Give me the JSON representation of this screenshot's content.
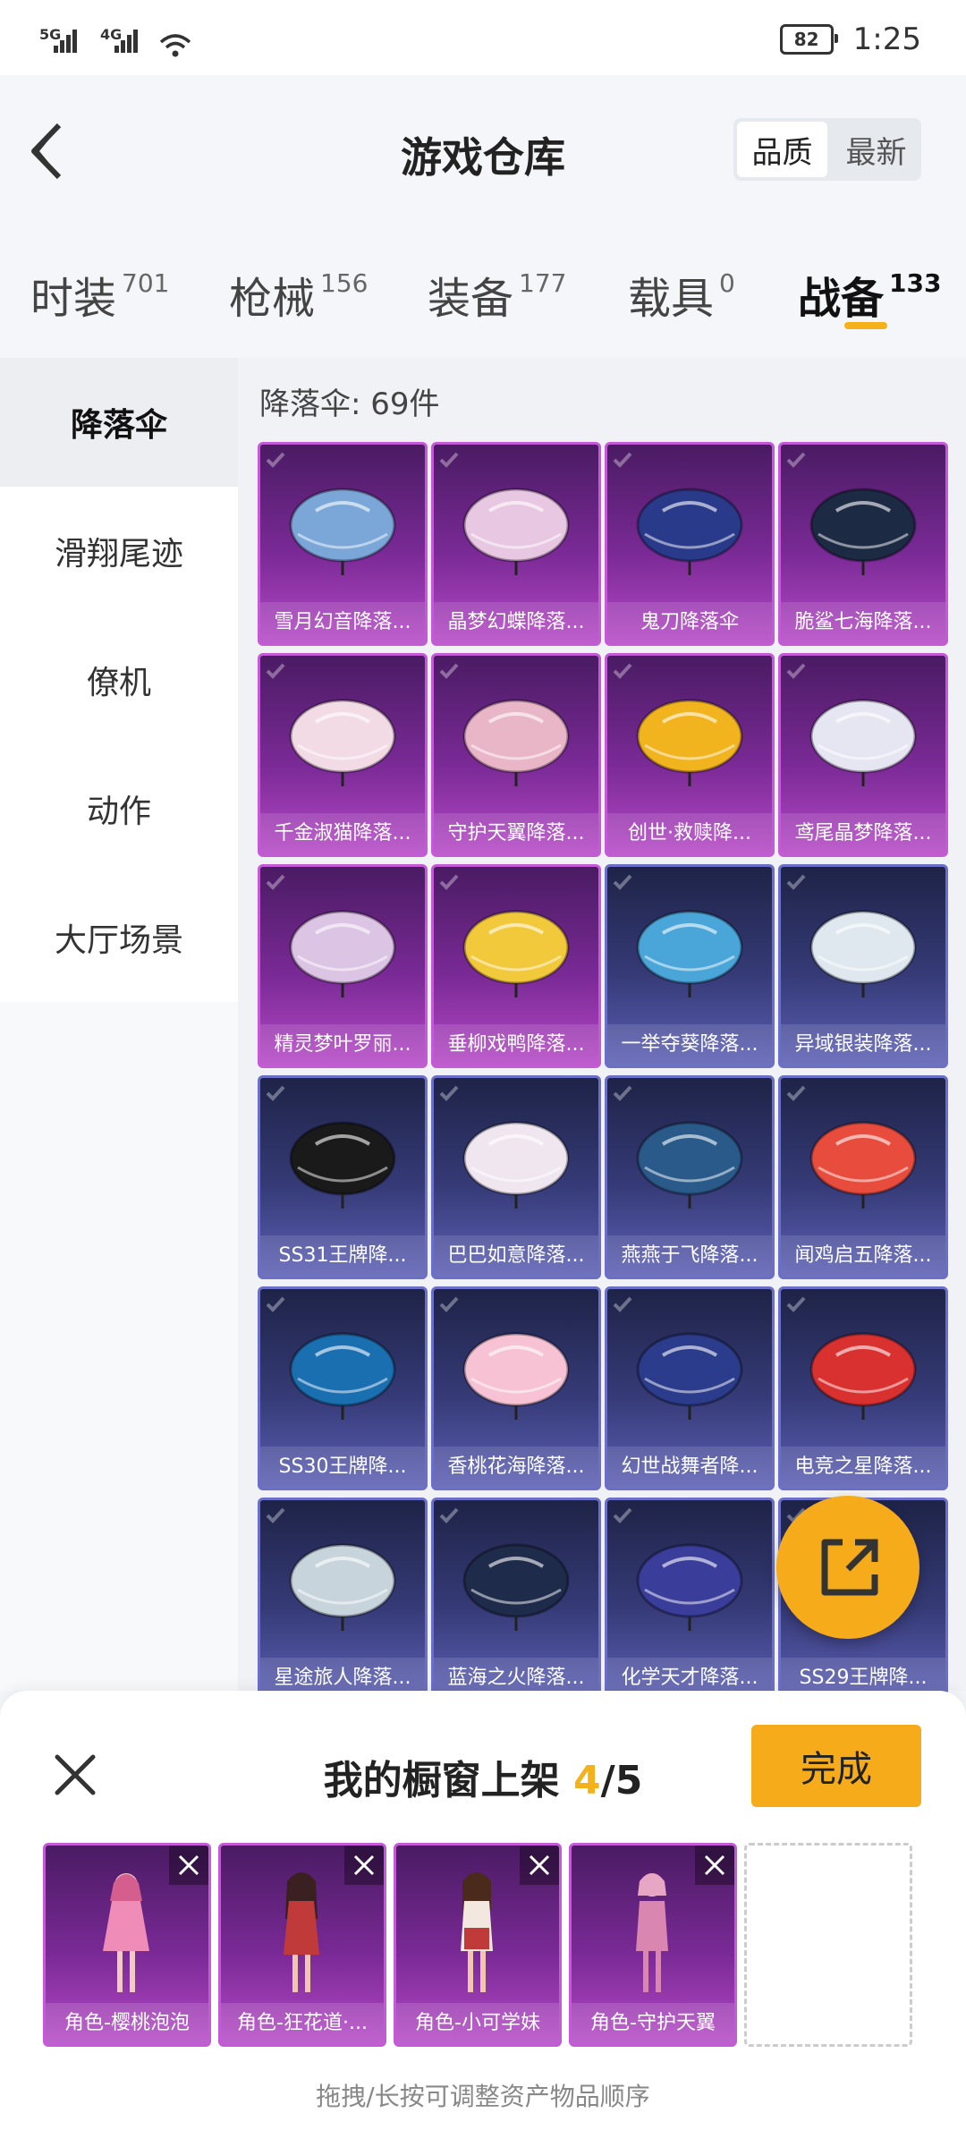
{
  "status": {
    "signal1": "5G",
    "signal2": "4G",
    "battery": "82",
    "time": "1:25"
  },
  "header": {
    "title": "游戏仓库",
    "sort_options": [
      "品质",
      "最新"
    ]
  },
  "tabs": [
    {
      "label": "时装",
      "count": "701"
    },
    {
      "label": "枪械",
      "count": "156"
    },
    {
      "label": "装备",
      "count": "177"
    },
    {
      "label": "载具",
      "count": "0"
    },
    {
      "label": "战备",
      "count": "133"
    }
  ],
  "sidebar": {
    "items": [
      "降落伞",
      "滑翔尾迹",
      "僚机",
      "动作",
      "大厅场景"
    ]
  },
  "main": {
    "count_label": "降落伞: 69件"
  },
  "items": [
    {
      "label": "雪月幻音降落...",
      "tier": "purple"
    },
    {
      "label": "晶梦幻蝶降落...",
      "tier": "purple"
    },
    {
      "label": "鬼刀降落伞",
      "tier": "purple"
    },
    {
      "label": "脆鲨七海降落...",
      "tier": "purple"
    },
    {
      "label": "千金淑猫降落...",
      "tier": "purple"
    },
    {
      "label": "守护天翼降落...",
      "tier": "purple"
    },
    {
      "label": "创世·救赎降...",
      "tier": "purple"
    },
    {
      "label": "鸢尾晶梦降落...",
      "tier": "purple"
    },
    {
      "label": "精灵梦叶罗丽...",
      "tier": "purple"
    },
    {
      "label": "垂柳戏鸭降落...",
      "tier": "purple"
    },
    {
      "label": "一举夺葵降落...",
      "tier": "blue"
    },
    {
      "label": "异域银装降落...",
      "tier": "blue"
    },
    {
      "label": "SS31王牌降...",
      "tier": "blue"
    },
    {
      "label": "巴巴如意降落...",
      "tier": "blue"
    },
    {
      "label": "燕燕于飞降落...",
      "tier": "blue"
    },
    {
      "label": "闻鸡启五降落...",
      "tier": "blue"
    },
    {
      "label": "SS30王牌降...",
      "tier": "blue"
    },
    {
      "label": "香桃花海降落...",
      "tier": "blue"
    },
    {
      "label": "幻世战舞者降...",
      "tier": "blue"
    },
    {
      "label": "电竞之星降落...",
      "tier": "blue"
    },
    {
      "label": "星途旅人降落...",
      "tier": "blue"
    },
    {
      "label": "蓝海之火降落...",
      "tier": "blue"
    },
    {
      "label": "化学天才降落...",
      "tier": "blue"
    },
    {
      "label": "SS29王牌降...",
      "tier": "blue"
    }
  ],
  "colors": {
    "accent": "#f6ab1a",
    "purple_card": "#7a2a96",
    "blue_card": "#363b78"
  },
  "showcase": {
    "title_prefix": "我的橱窗上架 ",
    "current": "4",
    "total": "/5",
    "done_label": "完成",
    "slots": [
      "角色-樱桃泡泡",
      "角色-狂花道·...",
      "角色-小可学妹",
      "角色-守护天翼"
    ],
    "hint": "拖拽/长按可调整资产物品顺序"
  }
}
